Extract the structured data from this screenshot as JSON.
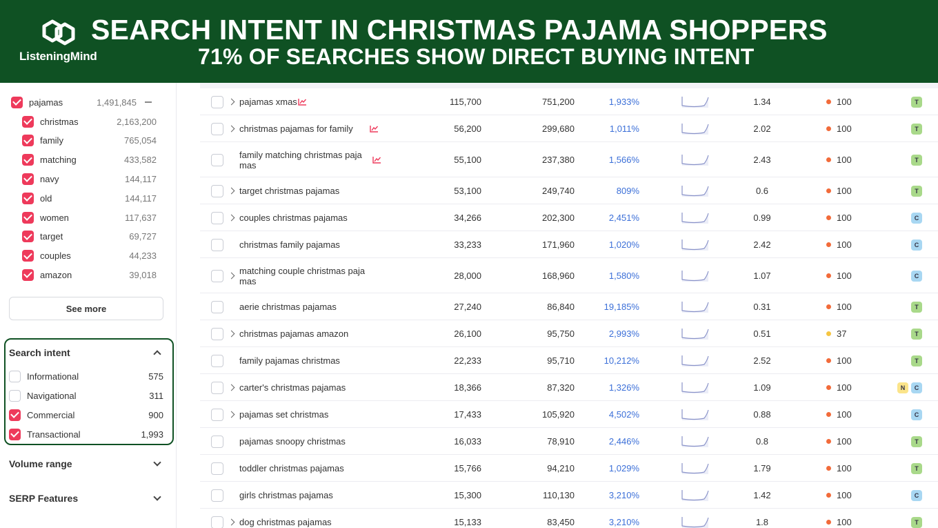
{
  "banner": {
    "logo_text": "ListeningMind",
    "title": "SEARCH INTENT IN CHRISTMAS PAJAMA SHOPPERS",
    "subtitle": "71% OF SEARCHES SHOW DIRECT BUYING INTENT"
  },
  "sidebar": {
    "root_keyword": {
      "label": "pajamas",
      "count": "1,491,845",
      "checked": true
    },
    "keywords": [
      {
        "label": "christmas",
        "count": "2,163,200",
        "checked": true
      },
      {
        "label": "family",
        "count": "765,054",
        "checked": true
      },
      {
        "label": "matching",
        "count": "433,582",
        "checked": true
      },
      {
        "label": "navy",
        "count": "144,117",
        "checked": true
      },
      {
        "label": "old",
        "count": "144,117",
        "checked": true
      },
      {
        "label": "women",
        "count": "117,637",
        "checked": true
      },
      {
        "label": "target",
        "count": "69,727",
        "checked": true
      },
      {
        "label": "couples",
        "count": "44,233",
        "checked": true
      },
      {
        "label": "amazon",
        "count": "39,018",
        "checked": true
      }
    ],
    "see_more": "See more",
    "search_intent": {
      "title": "Search intent",
      "options": [
        {
          "label": "Informational",
          "count": "575",
          "checked": false
        },
        {
          "label": "Navigational",
          "count": "311",
          "checked": false
        },
        {
          "label": "Commercial",
          "count": "900",
          "checked": true
        },
        {
          "label": "Transactional",
          "count": "1,993",
          "checked": true
        }
      ]
    },
    "volume_range": "Volume range",
    "serp_features": "SERP Features"
  },
  "colors": {
    "banner": "#0f5123",
    "accent": "#ee3a5b",
    "link": "#3b6fd8",
    "dot_high": "#f26b3a",
    "dot_mid": "#f5c542"
  },
  "table": {
    "rows": [
      {
        "keyword": [
          "pajamas xmas"
        ],
        "caret": true,
        "trend": true,
        "volume": "115,700",
        "total": "751,200",
        "growth": "1,933%",
        "cpc": "1.34",
        "kd": "100",
        "dot": "high",
        "badges": [
          "T"
        ]
      },
      {
        "keyword": [
          "christmas pajamas for family"
        ],
        "caret": true,
        "trend": true,
        "volume": "56,200",
        "total": "299,680",
        "growth": "1,011%",
        "cpc": "2.02",
        "kd": "100",
        "dot": "high",
        "badges": [
          "T"
        ]
      },
      {
        "keyword": [
          "family matching christmas paja",
          "mas"
        ],
        "caret": false,
        "trend": true,
        "volume": "55,100",
        "total": "237,380",
        "growth": "1,566%",
        "cpc": "2.43",
        "kd": "100",
        "dot": "high",
        "badges": [
          "T"
        ]
      },
      {
        "keyword": [
          "target christmas pajamas"
        ],
        "caret": true,
        "trend": false,
        "volume": "53,100",
        "total": "249,740",
        "growth": "809%",
        "cpc": "0.6",
        "kd": "100",
        "dot": "high",
        "badges": [
          "T"
        ]
      },
      {
        "keyword": [
          "couples christmas pajamas"
        ],
        "caret": true,
        "trend": false,
        "volume": "34,266",
        "total": "202,300",
        "growth": "2,451%",
        "cpc": "0.99",
        "kd": "100",
        "dot": "high",
        "badges": [
          "C"
        ]
      },
      {
        "keyword": [
          "christmas family pajamas"
        ],
        "caret": false,
        "trend": false,
        "volume": "33,233",
        "total": "171,960",
        "growth": "1,020%",
        "cpc": "2.42",
        "kd": "100",
        "dot": "high",
        "badges": [
          "C"
        ]
      },
      {
        "keyword": [
          "matching couple christmas paja",
          "mas"
        ],
        "caret": true,
        "trend": false,
        "volume": "28,000",
        "total": "168,960",
        "growth": "1,580%",
        "cpc": "1.07",
        "kd": "100",
        "dot": "high",
        "badges": [
          "C"
        ]
      },
      {
        "keyword": [
          "aerie christmas pajamas"
        ],
        "caret": false,
        "trend": false,
        "volume": "27,240",
        "total": "86,840",
        "growth": "19,185%",
        "cpc": "0.31",
        "kd": "100",
        "dot": "high",
        "badges": [
          "T"
        ]
      },
      {
        "keyword": [
          "christmas pajamas amazon"
        ],
        "caret": true,
        "trend": false,
        "volume": "26,100",
        "total": "95,750",
        "growth": "2,993%",
        "cpc": "0.51",
        "kd": "37",
        "dot": "mid",
        "badges": [
          "T"
        ]
      },
      {
        "keyword": [
          "family pajamas christmas"
        ],
        "caret": false,
        "trend": false,
        "volume": "22,233",
        "total": "95,710",
        "growth": "10,212%",
        "cpc": "2.52",
        "kd": "100",
        "dot": "high",
        "badges": [
          "T"
        ]
      },
      {
        "keyword": [
          "carter's christmas pajamas"
        ],
        "caret": true,
        "trend": false,
        "volume": "18,366",
        "total": "87,320",
        "growth": "1,326%",
        "cpc": "1.09",
        "kd": "100",
        "dot": "high",
        "badges": [
          "N",
          "C"
        ]
      },
      {
        "keyword": [
          "pajamas set christmas"
        ],
        "caret": true,
        "trend": false,
        "volume": "17,433",
        "total": "105,920",
        "growth": "4,502%",
        "cpc": "0.88",
        "kd": "100",
        "dot": "high",
        "badges": [
          "C"
        ]
      },
      {
        "keyword": [
          "pajamas snoopy christmas"
        ],
        "caret": false,
        "trend": false,
        "volume": "16,033",
        "total": "78,910",
        "growth": "2,446%",
        "cpc": "0.8",
        "kd": "100",
        "dot": "high",
        "badges": [
          "T"
        ]
      },
      {
        "keyword": [
          "toddler christmas pajamas"
        ],
        "caret": false,
        "trend": false,
        "volume": "15,766",
        "total": "94,210",
        "growth": "1,029%",
        "cpc": "1.79",
        "kd": "100",
        "dot": "high",
        "badges": [
          "T"
        ]
      },
      {
        "keyword": [
          "girls christmas pajamas"
        ],
        "caret": false,
        "trend": false,
        "volume": "15,300",
        "total": "110,130",
        "growth": "3,210%",
        "cpc": "1.42",
        "kd": "100",
        "dot": "high",
        "badges": [
          "C"
        ]
      },
      {
        "keyword": [
          "dog christmas pajamas"
        ],
        "caret": true,
        "trend": false,
        "volume": "15,133",
        "total": "83,450",
        "growth": "3,210%",
        "cpc": "1.8",
        "kd": "100",
        "dot": "high",
        "badges": [
          "T"
        ]
      }
    ]
  }
}
